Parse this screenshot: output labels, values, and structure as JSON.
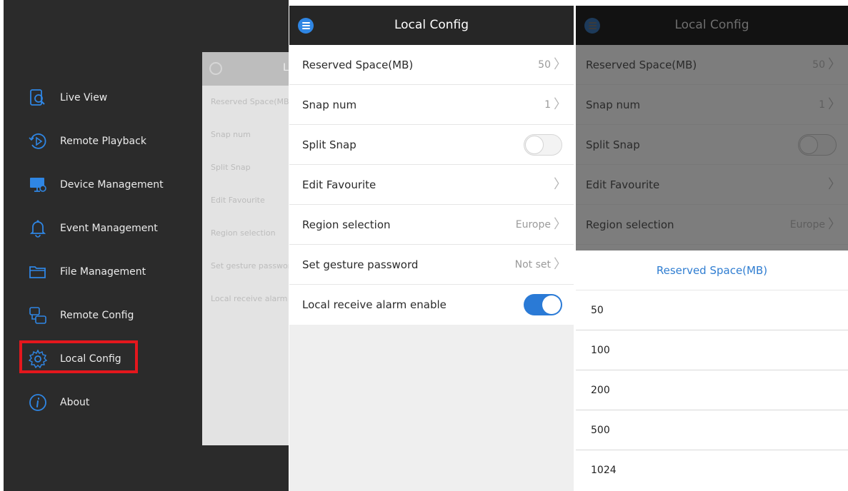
{
  "menu": {
    "items": [
      {
        "label": "Live View",
        "icon": "live-view-icon"
      },
      {
        "label": "Remote Playback",
        "icon": "playback-icon"
      },
      {
        "label": "Device Management",
        "icon": "device-icon"
      },
      {
        "label": "Event Management",
        "icon": "bell-icon"
      },
      {
        "label": "File Management",
        "icon": "folder-icon"
      },
      {
        "label": "Remote Config",
        "icon": "remote-config-icon"
      },
      {
        "label": "Local Config",
        "icon": "gear-icon"
      },
      {
        "label": "About",
        "icon": "info-icon"
      }
    ],
    "peek": {
      "title": "L",
      "rows": [
        "Reserved Space(MB)",
        "Snap num",
        "Split Snap",
        "Edit Favourite",
        "Region selection",
        "Set gesture password",
        "Local receive alarm enable"
      ]
    }
  },
  "config": {
    "title": "Local Config",
    "rows": [
      {
        "label": "Reserved Space(MB)",
        "value": "50"
      },
      {
        "label": "Snap num",
        "value": "1"
      },
      {
        "label": "Split Snap",
        "toggle": "off"
      },
      {
        "label": "Edit Favourite",
        "value": ""
      },
      {
        "label": "Region selection",
        "value": "Europe"
      },
      {
        "label": "Set gesture password",
        "value": "Not set"
      },
      {
        "label": "Local receive alarm enable",
        "toggle": "on"
      }
    ]
  },
  "picker": {
    "title": "Reserved Space(MB)",
    "options": [
      "50",
      "100",
      "200",
      "500",
      "1024"
    ]
  },
  "colors": {
    "accent": "#2a7ad6",
    "highlight": "#e4171d",
    "menu_bg": "#2b2b2b",
    "topbar_bg": "#262626"
  }
}
